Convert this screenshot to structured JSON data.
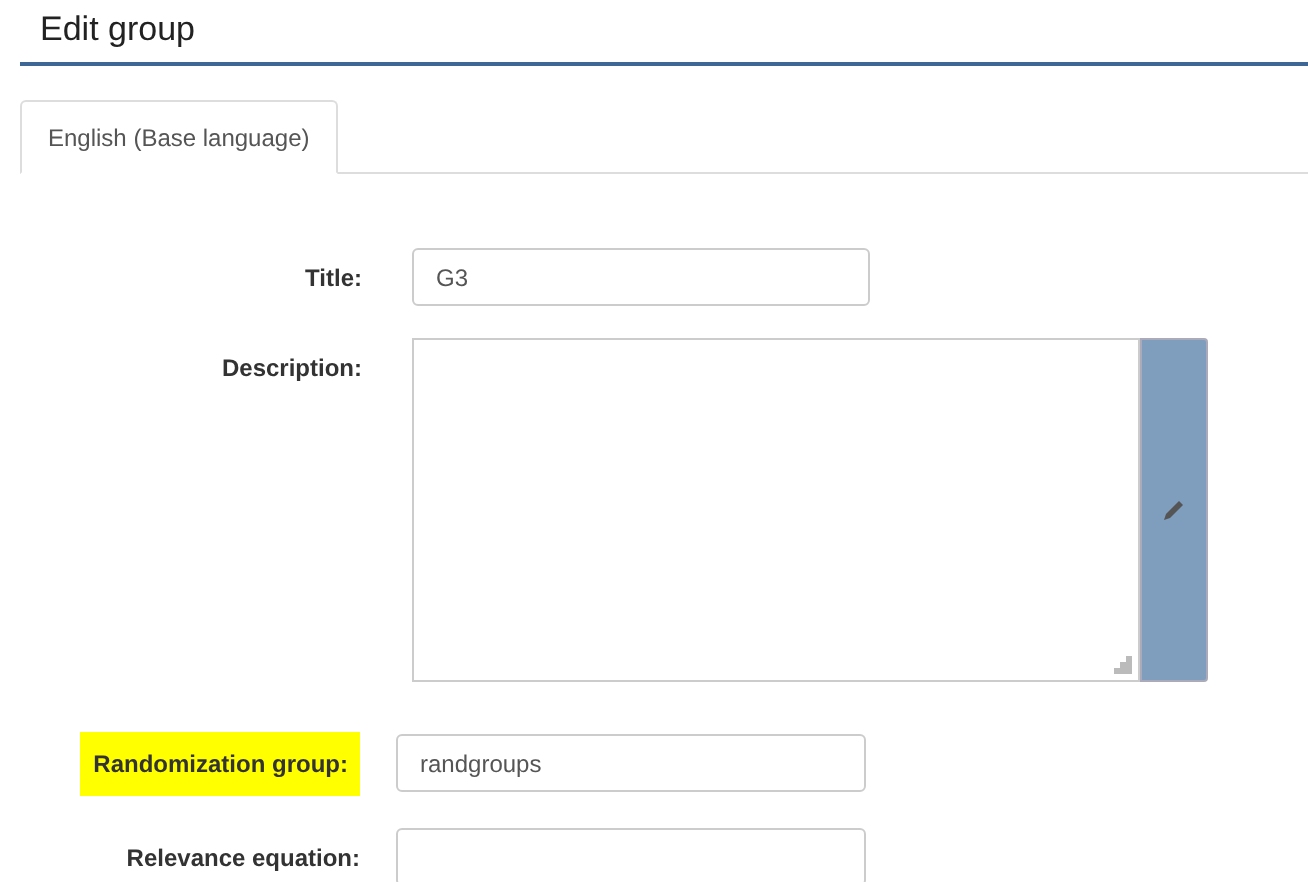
{
  "heading": "Edit group",
  "tabs": [
    {
      "label": "English (Base language)",
      "selected": true
    }
  ],
  "fields": [
    {
      "kind": "input",
      "label": "Title:",
      "value": "G3",
      "highlighted": false
    },
    {
      "kind": "editor",
      "label": "Description:",
      "highlighted": false
    },
    {
      "kind": "input",
      "label": "Randomization group:",
      "value": "randgroups",
      "highlighted": true
    },
    {
      "kind": "input",
      "label": "Relevance equation:",
      "highlighted": false
    }
  ]
}
